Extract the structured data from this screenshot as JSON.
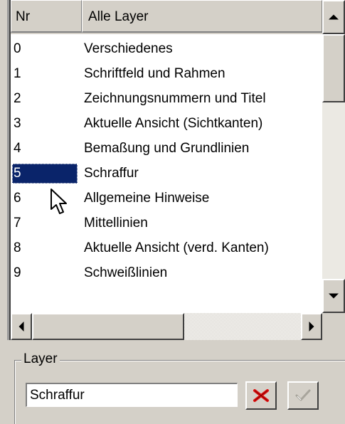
{
  "layer_list": {
    "columns": {
      "nr": "Nr",
      "name": "Alle Layer"
    },
    "rows": [
      {
        "nr": "0",
        "name": "Verschiedenes"
      },
      {
        "nr": "1",
        "name": "Schriftfeld und Rahmen"
      },
      {
        "nr": "2",
        "name": "Zeichnungsnummern und Titel"
      },
      {
        "nr": "3",
        "name": "Aktuelle Ansicht (Sichtkanten)"
      },
      {
        "nr": "4",
        "name": "Bemaßung und Grundlinien"
      },
      {
        "nr": "5",
        "name": "Schraffur"
      },
      {
        "nr": "6",
        "name": "Allgemeine Hinweise"
      },
      {
        "nr": "7",
        "name": "Mittellinien"
      },
      {
        "nr": "8",
        "name": "Aktuelle Ansicht (verd. Kanten)"
      },
      {
        "nr": "9",
        "name": "Schweißlinien"
      }
    ],
    "selected_nr": "5"
  },
  "layer_group": {
    "label": "Layer",
    "input_value": "Schraffur",
    "delete_icon": "red-x-icon",
    "confirm_icon": "checkmark-icon"
  },
  "colors": {
    "selection": "#0a246a",
    "delete_icon": "#e01010",
    "face": "#d4d0c8"
  }
}
